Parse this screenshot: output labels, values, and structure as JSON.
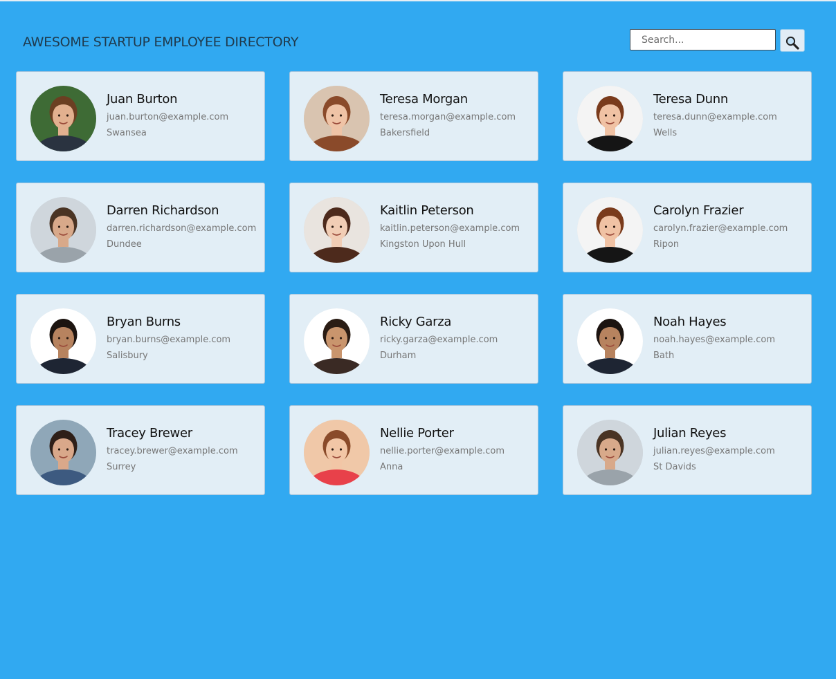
{
  "header": {
    "title": "AWESOME STARTUP EMPLOYEE DIRECTORY"
  },
  "search": {
    "placeholder": "Search...",
    "value": "",
    "button_icon": "magnifier-icon"
  },
  "colors": {
    "page_background": "#31a9f1",
    "card_background": "#e2eef6"
  },
  "employees": [
    {
      "name": "Juan Burton",
      "email": "juan.burton@example.com",
      "city": "Swansea",
      "avatar": {
        "bg": "#3e6b35",
        "skin": "#e2b08f",
        "hair": "#6b3f22",
        "shirt": "#2a3340"
      }
    },
    {
      "name": "Teresa Morgan",
      "email": "teresa.morgan@example.com",
      "city": "Bakersfield",
      "avatar": {
        "bg": "#d9c4b0",
        "skin": "#efc3a6",
        "hair": "#8a4a2a",
        "shirt": "#8a4a2a"
      }
    },
    {
      "name": "Teresa Dunn",
      "email": "teresa.dunn@example.com",
      "city": "Wells",
      "avatar": {
        "bg": "#f4f4f4",
        "skin": "#f0c2a4",
        "hair": "#7a3b1c",
        "shirt": "#151515"
      }
    },
    {
      "name": "Darren Richardson",
      "email": "darren.richardson@example.com",
      "city": "Dundee",
      "avatar": {
        "bg": "#cfd6dc",
        "skin": "#d8a98a",
        "hair": "#4a3424",
        "shirt": "#9aa3aa"
      }
    },
    {
      "name": "Kaitlin Peterson",
      "email": "kaitlin.peterson@example.com",
      "city": "Kingston Upon Hull",
      "avatar": {
        "bg": "#e9e4df",
        "skin": "#f1cdb5",
        "hair": "#4d2a1c",
        "shirt": "#4d2a1c"
      }
    },
    {
      "name": "Carolyn Frazier",
      "email": "carolyn.frazier@example.com",
      "city": "Ripon",
      "avatar": {
        "bg": "#f4f4f4",
        "skin": "#f0c2a4",
        "hair": "#7a3b1c",
        "shirt": "#151515"
      }
    },
    {
      "name": "Bryan Burns",
      "email": "bryan.burns@example.com",
      "city": "Salisbury",
      "avatar": {
        "bg": "#ffffff",
        "skin": "#b7835f",
        "hair": "#1c1410",
        "shirt": "#1e2533"
      }
    },
    {
      "name": "Ricky Garza",
      "email": "ricky.garza@example.com",
      "city": "Durham",
      "avatar": {
        "bg": "#ffffff",
        "skin": "#c9956d",
        "hair": "#2a1c14",
        "shirt": "#3a2a24"
      }
    },
    {
      "name": "Noah Hayes",
      "email": "noah.hayes@example.com",
      "city": "Bath",
      "avatar": {
        "bg": "#ffffff",
        "skin": "#b7835f",
        "hair": "#1c1410",
        "shirt": "#1e2533"
      }
    },
    {
      "name": "Tracey Brewer",
      "email": "tracey.brewer@example.com",
      "city": "Surrey",
      "avatar": {
        "bg": "#8fa7b8",
        "skin": "#d9a88a",
        "hair": "#2e1f18",
        "shirt": "#3d5a80"
      }
    },
    {
      "name": "Nellie Porter",
      "email": "nellie.porter@example.com",
      "city": "Anna",
      "avatar": {
        "bg": "#f0c8a8",
        "skin": "#f2c6a6",
        "hair": "#8a4b2a",
        "shirt": "#e8414a"
      }
    },
    {
      "name": "Julian Reyes",
      "email": "julian.reyes@example.com",
      "city": "St Davids",
      "avatar": {
        "bg": "#cfd6dc",
        "skin": "#d8a98a",
        "hair": "#4a3424",
        "shirt": "#9aa3aa"
      }
    }
  ]
}
